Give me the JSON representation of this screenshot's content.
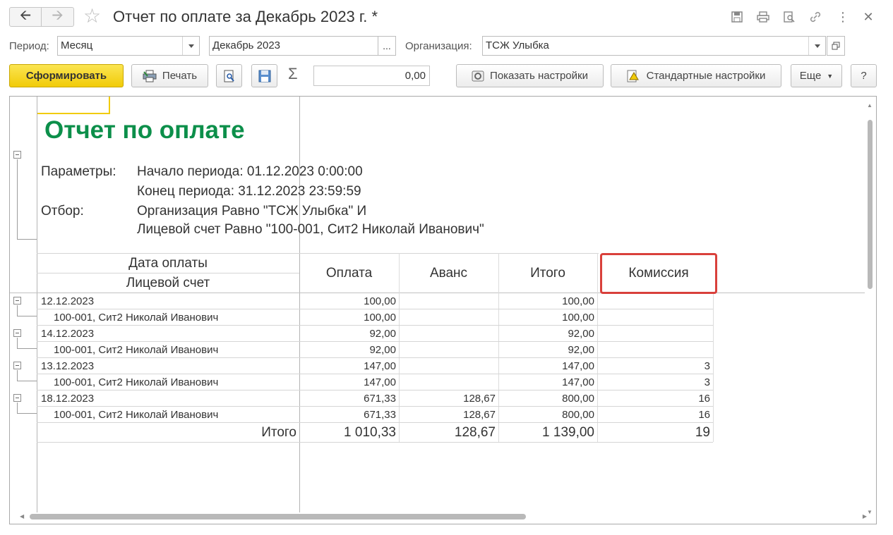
{
  "window": {
    "title": "Отчет по оплате за Декабрь 2023 г. *"
  },
  "filters": {
    "period_label": "Период:",
    "period_value": "Месяц",
    "month_value": "Декабрь 2023",
    "month_select_label": "...",
    "org_label": "Организация:",
    "org_value": "ТСЖ Улыбка"
  },
  "toolbar": {
    "generate_label": "Сформировать",
    "print_label": "Печать",
    "sum_symbol": "Σ",
    "sum_value": "0,00",
    "show_settings_label": "Показать настройки",
    "standard_settings_label": "Стандартные настройки",
    "more_label": "Еще",
    "help_label": "?"
  },
  "report": {
    "title": "Отчет по оплате",
    "params_label": "Параметры:",
    "param_start": "Начало периода: 01.12.2023 0:00:00",
    "param_end": "Конец периода: 31.12.2023 23:59:59",
    "filter_label": "Отбор:",
    "filter_line1": "Организация Равно \"ТСЖ Улыбка\" И",
    "filter_line2": "Лицевой счет Равно \"100-001, Сит2 Николай Иванович\"",
    "columns": {
      "date": "Дата оплаты",
      "account": "Лицевой счет",
      "payment": "Оплата",
      "advance": "Аванс",
      "total": "Итого",
      "commission": "Комиссия"
    },
    "rows": [
      {
        "label": "12.12.2023",
        "payment": "100,00",
        "advance": "",
        "total": "100,00",
        "commission": ""
      },
      {
        "label": "100-001, Сит2 Николай Иванович",
        "payment": "100,00",
        "advance": "",
        "total": "100,00",
        "commission": ""
      },
      {
        "label": "14.12.2023",
        "payment": "92,00",
        "advance": "",
        "total": "92,00",
        "commission": ""
      },
      {
        "label": "100-001, Сит2 Николай Иванович",
        "payment": "92,00",
        "advance": "",
        "total": "92,00",
        "commission": ""
      },
      {
        "label": "13.12.2023",
        "payment": "147,00",
        "advance": "",
        "total": "147,00",
        "commission": "3"
      },
      {
        "label": "100-001, Сит2 Николай Иванович",
        "payment": "147,00",
        "advance": "",
        "total": "147,00",
        "commission": "3"
      },
      {
        "label": "18.12.2023",
        "payment": "671,33",
        "advance": "128,67",
        "total": "800,00",
        "commission": "16"
      },
      {
        "label": "100-001, Сит2 Николай Иванович",
        "payment": "671,33",
        "advance": "128,67",
        "total": "800,00",
        "commission": "16"
      }
    ],
    "totals": {
      "label": "Итого",
      "payment": "1 010,33",
      "advance": "128,67",
      "total": "1 139,00",
      "commission": "19"
    }
  },
  "colors": {
    "report_title": "#0c8f4a",
    "highlight": "#d9403b",
    "primary_button": "#f1cb08"
  }
}
